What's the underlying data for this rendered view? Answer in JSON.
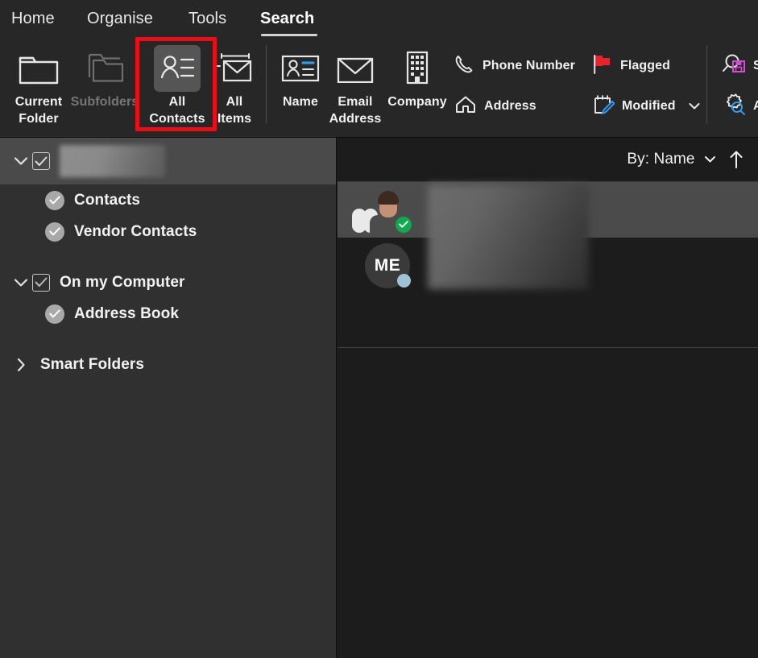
{
  "ribbon": {
    "tabs": [
      {
        "label": "Home",
        "active": false
      },
      {
        "label": "Organise",
        "active": false
      },
      {
        "label": "Tools",
        "active": false
      },
      {
        "label": "Search",
        "active": true
      }
    ],
    "scope_buttons": [
      {
        "label_line1": "Current",
        "label_line2": "Folder",
        "icon": "folder-icon",
        "state": "normal"
      },
      {
        "label_line1": "Subfolders",
        "label_line2": "",
        "icon": "subfolders-icon",
        "state": "disabled"
      },
      {
        "label_line1": "All",
        "label_line2": "Contacts",
        "icon": "contact-card-icon",
        "state": "selected"
      },
      {
        "label_line1": "All",
        "label_line2": "Items",
        "icon": "all-items-icon",
        "state": "normal"
      }
    ],
    "criteria_buttons": [
      {
        "label": "Name",
        "label_line2": "",
        "icon": "name-card-icon"
      },
      {
        "label": "Email",
        "label_line2": "Address",
        "icon": "envelope-icon"
      },
      {
        "label": "Company",
        "label_line2": "",
        "icon": "building-icon"
      }
    ],
    "filter_buttons": [
      {
        "label": "Phone Number",
        "icon": "phone-icon",
        "chevron": false
      },
      {
        "label": "Flagged",
        "icon": "flag-icon",
        "chevron": false
      },
      {
        "label": "Address",
        "icon": "home-icon",
        "chevron": false
      },
      {
        "label": "Modified",
        "icon": "calendar-edit-icon",
        "chevron": true
      }
    ],
    "right_buttons": [
      {
        "label": "S",
        "icon": "save-search-icon"
      },
      {
        "label": "A",
        "icon": "advanced-search-icon"
      }
    ]
  },
  "sidebar": {
    "rows": [
      {
        "label": "",
        "redacted": true,
        "control": "checkbox",
        "twisty": "down",
        "indent": 0,
        "selected": true
      },
      {
        "label": "Contacts",
        "redacted": false,
        "control": "circle",
        "twisty": "none",
        "indent": 1,
        "selected": false
      },
      {
        "label": "Vendor Contacts",
        "redacted": false,
        "control": "circle",
        "twisty": "none",
        "indent": 1,
        "selected": false
      },
      {
        "label": "On my Computer",
        "redacted": false,
        "control": "checkbox",
        "twisty": "down",
        "indent": 0,
        "selected": false
      },
      {
        "label": "Address Book",
        "redacted": false,
        "control": "circle",
        "twisty": "none",
        "indent": 1,
        "selected": false
      },
      {
        "label": "Smart Folders",
        "redacted": false,
        "control": "none",
        "twisty": "right",
        "indent": 0,
        "selected": false
      }
    ]
  },
  "list": {
    "sort": {
      "label": "By: Name",
      "chevron_icon": "chevron-down-icon",
      "direction_icon": "arrow-up-icon"
    },
    "contacts": [
      {
        "name": "",
        "redacted": true,
        "avatar_type": "photo",
        "initials": "",
        "presence": "available",
        "selected": true
      },
      {
        "name": "",
        "redacted": true,
        "avatar_type": "initials",
        "initials": "ME",
        "presence": "offline",
        "selected": false
      }
    ]
  },
  "annotation": {
    "highlight_color": "#ec0e16",
    "target": "All Contacts"
  }
}
